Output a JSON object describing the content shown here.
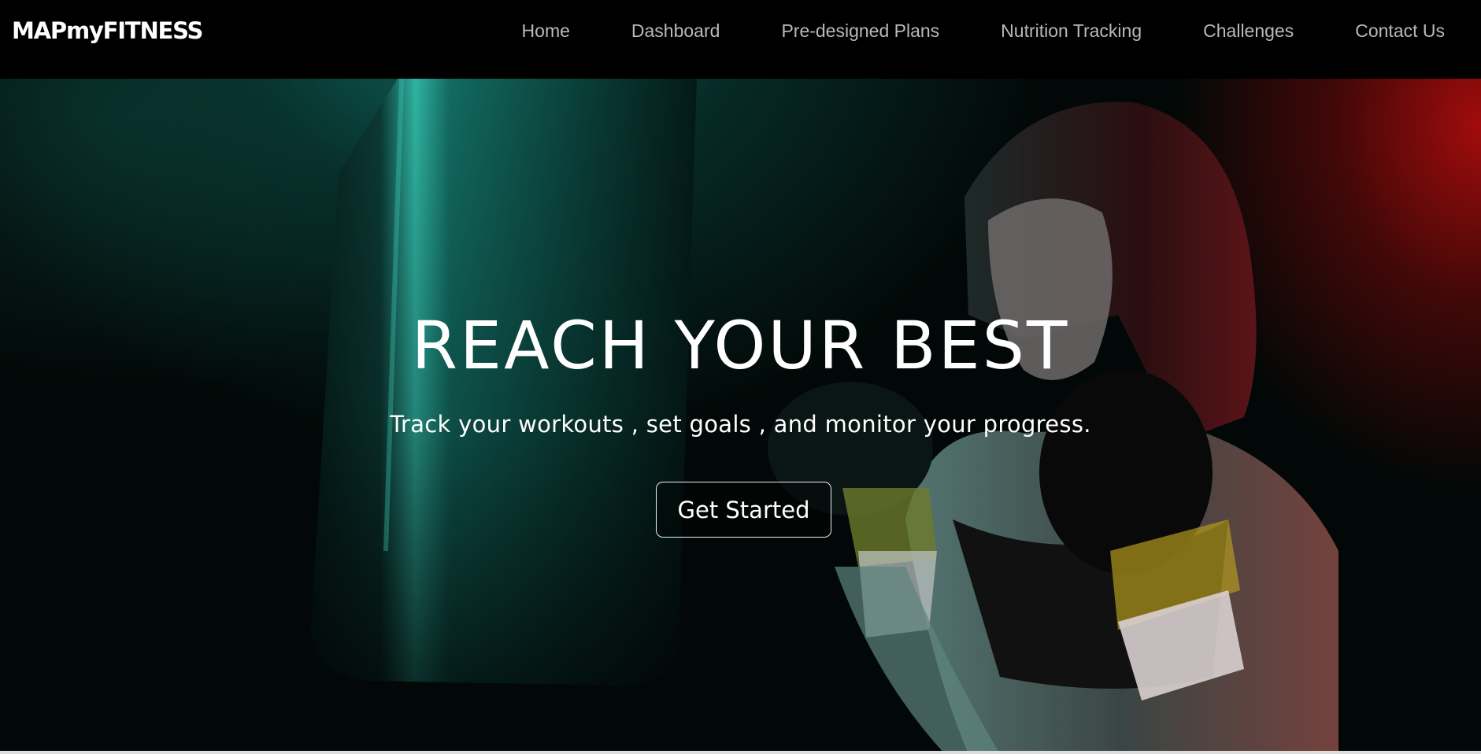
{
  "brand": {
    "logo_text": "MAPmyFITNESS"
  },
  "nav": {
    "items": [
      {
        "label": "Home"
      },
      {
        "label": "Dashboard"
      },
      {
        "label": "Pre-designed Plans"
      },
      {
        "label": "Nutrition Tracking"
      },
      {
        "label": "Challenges"
      },
      {
        "label": "Contact Us"
      }
    ]
  },
  "hero": {
    "headline": "REACH YOUR BEST",
    "subtitle": "Track your workouts , set goals , and monitor your progress.",
    "cta_label": "Get Started",
    "image_subject": "boxer woman with punching bag"
  },
  "colors": {
    "nav_bg": "#000000",
    "nav_text": "#b9b9b9",
    "logo_text": "#ffffff",
    "accent_teal": "#14786c",
    "accent_red": "#aa0c0c"
  }
}
